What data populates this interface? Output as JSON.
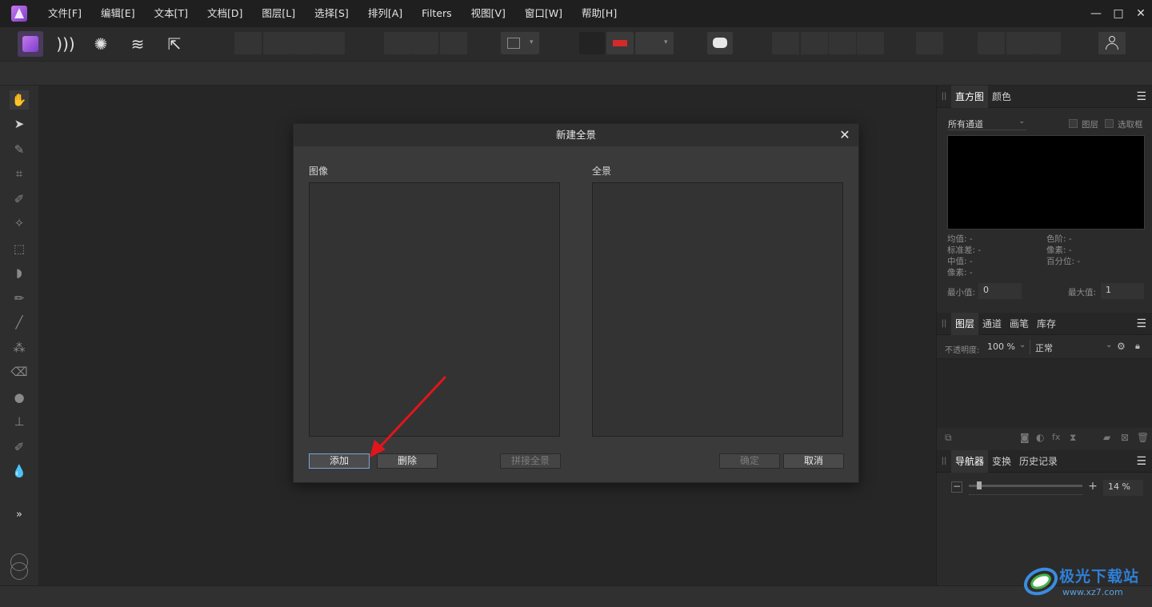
{
  "menubar": {
    "items": [
      "文件[F]",
      "编辑[E]",
      "文本[T]",
      "文档[D]",
      "图层[L]",
      "选择[S]",
      "排列[A]",
      "Filters",
      "视图[V]",
      "窗口[W]",
      "帮助[H]"
    ],
    "window_controls": [
      "—",
      "□",
      "✕"
    ]
  },
  "dialog": {
    "title": "新建全景",
    "close": "✕",
    "images_label": "图像",
    "panorama_label": "全景",
    "add_button": "添加",
    "delete_button": "删除",
    "stitch_button": "拼接全景",
    "ok_button": "确定",
    "cancel_button": "取消"
  },
  "histogram_panel": {
    "tabs": [
      "直方图",
      "颜色"
    ],
    "channel_select": "所有通道",
    "layer_checkbox": "图层",
    "selection_checkbox": "选取框",
    "stats_left": [
      "均值: -",
      "标准差: -",
      "中值: -",
      "像素: -"
    ],
    "stats_right": [
      "色阶: -",
      "像素: -",
      "百分位: -"
    ],
    "min_label": "最小值:",
    "min_value": "0",
    "max_label": "最大值:",
    "max_value": "1"
  },
  "layers_panel": {
    "tabs": [
      "图层",
      "通道",
      "画笔",
      "库存"
    ],
    "opacity_label": "不透明度:",
    "opacity_value": "100 %",
    "blend_mode": "正常"
  },
  "navigator_panel": {
    "tabs": [
      "导航器",
      "变换",
      "历史记录"
    ],
    "zoom_value": "14 %"
  },
  "tools": {
    "expand": "»"
  },
  "watermark": {
    "text_main": "极光下载站",
    "text_url": "www.xz7.com"
  },
  "colors": {
    "accent_purple": "#9b59d0",
    "arrow_red": "#e0161c"
  }
}
